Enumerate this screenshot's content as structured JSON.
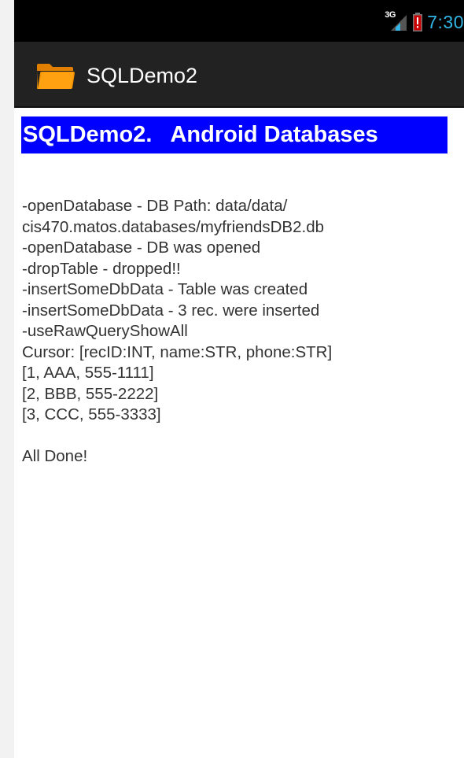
{
  "status_bar": {
    "network_type": "3G",
    "time": "7:30",
    "clock_color": "#33b5e5",
    "battery_icon": "battery-low-icon",
    "signal_icon": "signal-strength-icon"
  },
  "action_bar": {
    "app_icon": "folder-icon",
    "title": "SQLDemo2"
  },
  "header": {
    "text": "SQLDemo2.   Android Databases",
    "background": "#0000ff"
  },
  "log": {
    "lines": [
      "-openDatabase - DB Path: data/data/",
      "cis470.matos.databases/myfriendsDB2.db",
      "-openDatabase - DB was opened",
      "-dropTable - dropped!!",
      "-insertSomeDbData - Table was created",
      "-insertSomeDbData - 3 rec. were inserted",
      "-useRawQueryShowAll",
      "Cursor: [recID:INT, name:STR, phone:STR]",
      "[1, AAA, 555-1111]",
      "[2, BBB, 555-2222]",
      "[3, CCC, 555-3333]",
      "",
      "All Done!"
    ]
  }
}
